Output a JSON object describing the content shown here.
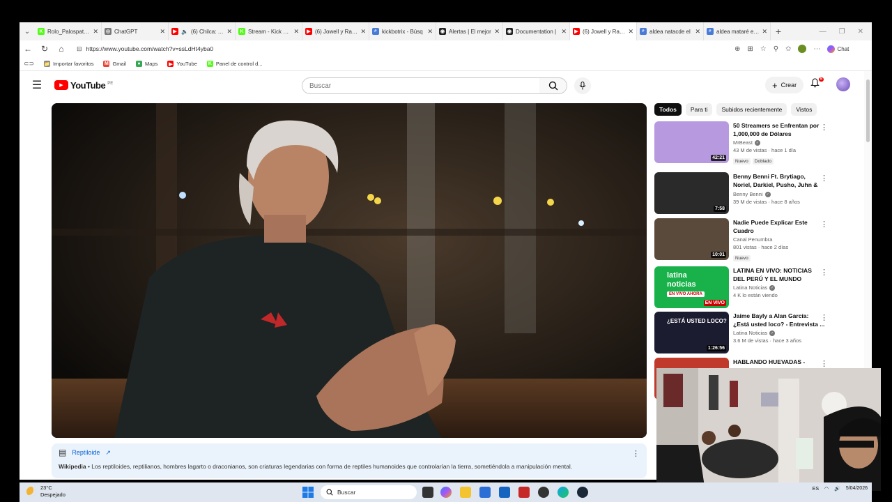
{
  "browser": {
    "tabs": [
      {
        "title": "Rolo_Palospatas S",
        "fav": "K",
        "fav_color": "#53fc18",
        "active": false
      },
      {
        "title": "ChatGPT",
        "fav": "◎",
        "fav_color": "#777777",
        "active": false
      },
      {
        "title": "(6) Chilca: La",
        "fav": "▶",
        "fav_color": "#ff0000",
        "active": false,
        "audio": true
      },
      {
        "title": "Stream - Kick Das",
        "fav": "K",
        "fav_color": "#53fc18",
        "active": false
      },
      {
        "title": "(6) Jowell y Randy",
        "fav": "▶",
        "fav_color": "#ff0000",
        "active": false
      },
      {
        "title": "kickbotrix - Búsq",
        "fav": "⌕",
        "fav_color": "#4a7bd6",
        "active": false
      },
      {
        "title": "Alertas | El mejor",
        "fav": "◉",
        "fav_color": "#222222",
        "active": false
      },
      {
        "title": "Documentation |",
        "fav": "◉",
        "fav_color": "#222222",
        "active": false
      },
      {
        "title": "(6) Jowell y Randy",
        "fav": "▶",
        "fav_color": "#ff0000",
        "active": true
      },
      {
        "title": "aldea natacde el",
        "fav": "⌕",
        "fav_color": "#4a7bd6",
        "active": false
      },
      {
        "title": "aldea mataré el g",
        "fav": "⌕",
        "fav_color": "#4a7bd6",
        "active": false
      }
    ],
    "url": "https://www.youtube.com/watch?v=ssLdHt4yba0",
    "chat_label": "Chat",
    "bookmarks": [
      {
        "label": "Importar favoritos",
        "icon": "📁",
        "color": "#888888"
      },
      {
        "label": "Gmail",
        "icon": "M",
        "color": "#ea4335"
      },
      {
        "label": "Maps",
        "icon": "●",
        "color": "#34a853"
      },
      {
        "label": "YouTube",
        "icon": "▶",
        "color": "#ff0000"
      },
      {
        "label": "Panel de control d...",
        "icon": "K",
        "color": "#53fc18"
      }
    ]
  },
  "youtube": {
    "logo_text": "YouTube",
    "country": "PE",
    "search_placeholder": "Buscar",
    "create_label": "Crear",
    "notif_count": "6",
    "chips": [
      "Todos",
      "Para ti",
      "Subidos recientemente",
      "Vistos"
    ],
    "info_panel": {
      "title": "Reptiloide",
      "source": "Wikipedia",
      "text": " • Los reptiloides, reptilianos, hombres lagarto o draconianos, son criaturas legendarias con forma de reptiles humanoides que controlarían la tierra, sometiéndola a manipulación mental."
    },
    "recommendations": [
      {
        "title": "50 Streamers se Enfrentan por 1,000,000 de Dólares",
        "channel": "MrBeast",
        "verified": true,
        "meta": "43 M de vistas · hace 1 día",
        "duration": "42:21",
        "badges": [
          "Nuevo",
          "Doblado"
        ],
        "thumb_color": "#b799e0"
      },
      {
        "title": "Benny Benni Ft. Brytiago, Noriel, Darkiel, Pusho, Juhn & Más - E...",
        "channel": "Benny Benni",
        "verified": true,
        "meta": "39 M de vistas · hace 8 años",
        "duration": "7:58",
        "badges": [],
        "thumb_color": "#2a2a2a"
      },
      {
        "title": "Nadie Puede Explicar Este Cuadro",
        "channel": "Canal Penumbra",
        "verified": false,
        "meta": "801 vistas · hace 2 días",
        "duration": "10:01",
        "badges": [
          "Nuevo"
        ],
        "thumb_color": "#5a4a3c"
      },
      {
        "title": "LATINA EN VIVO: NOTICIAS DEL PERÚ Y EL MUNDO",
        "channel": "Latina Noticias",
        "verified": true,
        "meta": "4 K lo están viendo",
        "duration": "EN VIVO",
        "badges": [],
        "thumb_color": "#19b14a",
        "thumb_text1": "latina",
        "thumb_text2": "noticias",
        "thumb_text3": "EN VIVO AHORA"
      },
      {
        "title": "Jaime Bayly a Alan García: ¿Está usted loco? - Entrevista ...",
        "channel": "Latina Noticias",
        "verified": true,
        "meta": "3.6 M de vistas · hace 3 años",
        "duration": "1:26:56",
        "badges": [],
        "thumb_color": "#1c1c30",
        "thumb_text1": "¿ESTÁ USTED LOCO?"
      },
      {
        "title": "HABLANDO HUEVADAS -",
        "channel": "",
        "verified": false,
        "meta": "",
        "duration": "",
        "badges": [],
        "thumb_color": "#c0392b"
      }
    ]
  },
  "taskbar": {
    "temp": "23°C",
    "weather": "Despejado",
    "search_label": "Buscar",
    "lang": "ES",
    "date": "5/04/2026"
  }
}
